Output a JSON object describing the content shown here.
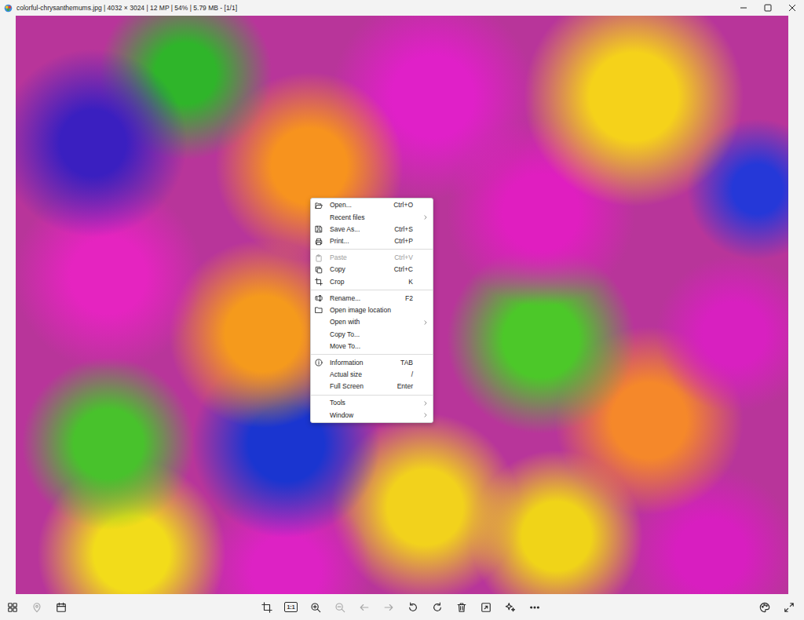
{
  "window": {
    "title": "colorful-chrysanthemums.jpg  |  4032 × 3024  |  12 MP  |  54%  |  5.79 MB  -  [1/1]"
  },
  "context_menu": {
    "groups": [
      [
        {
          "label": "Open...",
          "shortcut": "Ctrl+O",
          "submenu": false,
          "disabled": false
        },
        {
          "label": "Recent files",
          "shortcut": "",
          "submenu": true,
          "disabled": false
        },
        {
          "label": "Save As...",
          "shortcut": "Ctrl+S",
          "submenu": false,
          "disabled": false
        },
        {
          "label": "Print...",
          "shortcut": "Ctrl+P",
          "submenu": false,
          "disabled": false
        }
      ],
      [
        {
          "label": "Paste",
          "shortcut": "Ctrl+V",
          "submenu": false,
          "disabled": true
        },
        {
          "label": "Copy",
          "shortcut": "Ctrl+C",
          "submenu": false,
          "disabled": false
        },
        {
          "label": "Crop",
          "shortcut": "K",
          "submenu": false,
          "disabled": false
        }
      ],
      [
        {
          "label": "Rename...",
          "shortcut": "F2",
          "submenu": false,
          "disabled": false
        },
        {
          "label": "Open image location",
          "shortcut": "",
          "submenu": false,
          "disabled": false
        },
        {
          "label": "Open with",
          "shortcut": "",
          "submenu": true,
          "disabled": false
        },
        {
          "label": "Copy To...",
          "shortcut": "",
          "submenu": false,
          "disabled": false
        },
        {
          "label": "Move To...",
          "shortcut": "",
          "submenu": false,
          "disabled": false
        }
      ],
      [
        {
          "label": "Information",
          "shortcut": "TAB",
          "submenu": false,
          "disabled": false
        },
        {
          "label": "Actual size",
          "shortcut": "/",
          "submenu": false,
          "disabled": false
        },
        {
          "label": "Full Screen",
          "shortcut": "Enter",
          "submenu": false,
          "disabled": false
        }
      ],
      [
        {
          "label": "Tools",
          "shortcut": "",
          "submenu": true,
          "disabled": false
        },
        {
          "label": "Window",
          "shortcut": "",
          "submenu": true,
          "disabled": false
        }
      ]
    ]
  },
  "toolbar": {
    "left": [
      {
        "disabled": false
      },
      {
        "disabled": true
      },
      {
        "disabled": false
      }
    ],
    "center": [
      {
        "disabled": false
      },
      {
        "label": "1:1",
        "disabled": false
      },
      {
        "disabled": false
      },
      {
        "disabled": true
      },
      {
        "disabled": true
      },
      {
        "disabled": true
      },
      {
        "disabled": false
      },
      {
        "disabled": false
      },
      {
        "disabled": false
      },
      {
        "disabled": false
      },
      {
        "disabled": false
      },
      {
        "disabled": false
      }
    ],
    "right": [
      {
        "disabled": false
      },
      {
        "disabled": false
      }
    ]
  }
}
